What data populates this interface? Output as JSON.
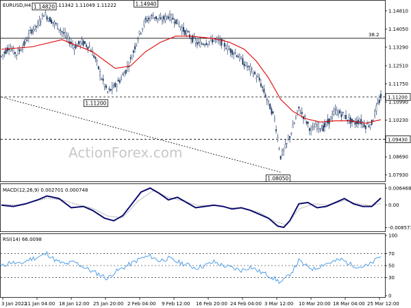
{
  "chart_data": {
    "type": "candlestick",
    "symbol_line": "EURUSD,H4  1.11101 1.11342 1.11049 1.11222",
    "watermark": "ActionForex.com",
    "y_ticks": [
      "1.14810",
      "1.14050",
      "1.13290",
      "1.12510",
      "1.11750",
      "1.10990",
      "1.10230",
      "1.09470",
      "1.08690",
      "1.07930"
    ],
    "y_range": [
      1.0775,
      1.1515
    ],
    "x_ticks": [
      "3 Jan 2022",
      "11 Jan 04:00",
      "18 Jan 12:00",
      "25 Jan 20:00",
      "2 Feb 04:00",
      "9 Feb 12:00",
      "16 Feb 20:00",
      "24 Feb 04:00",
      "3 Mar 12:00",
      "10 Mar 20:00",
      "18 Mar 04:00",
      "25 Mar 12:00"
    ],
    "price_labels": [
      {
        "text": "1.14820",
        "value": 1.1482,
        "bar": 28
      },
      {
        "text": "1.14940",
        "value": 1.1494,
        "bar": 95
      },
      {
        "text": "1.11200",
        "value": 1.112,
        "bar": 62
      },
      {
        "text": "1.08050",
        "value": 1.0805,
        "bar": 182
      }
    ],
    "fib_label": "38.2",
    "fib_level": 1.1366,
    "support_level": 1.0943,
    "support_label": "1.09430",
    "resistance_level": 1.112,
    "resistance_label": "1.11200",
    "trendline": [
      {
        "bar": 0,
        "value": 1.112
      },
      {
        "bar": 184,
        "value": 1.0805
      }
    ],
    "close_path": [
      [
        0,
        1.129
      ],
      [
        5,
        1.133
      ],
      [
        10,
        1.13
      ],
      [
        15,
        1.134
      ],
      [
        20,
        1.14
      ],
      [
        24,
        1.142
      ],
      [
        28,
        1.147
      ],
      [
        33,
        1.144
      ],
      [
        38,
        1.141
      ],
      [
        43,
        1.137
      ],
      [
        48,
        1.133
      ],
      [
        53,
        1.135
      ],
      [
        58,
        1.133
      ],
      [
        62,
        1.128
      ],
      [
        66,
        1.12
      ],
      [
        70,
        1.114
      ],
      [
        74,
        1.116
      ],
      [
        78,
        1.119
      ],
      [
        82,
        1.123
      ],
      [
        86,
        1.129
      ],
      [
        90,
        1.137
      ],
      [
        95,
        1.144
      ],
      [
        100,
        1.146
      ],
      [
        105,
        1.144
      ],
      [
        110,
        1.146
      ],
      [
        115,
        1.144
      ],
      [
        120,
        1.14
      ],
      [
        125,
        1.137
      ],
      [
        130,
        1.134
      ],
      [
        135,
        1.135
      ],
      [
        140,
        1.136
      ],
      [
        145,
        1.135
      ],
      [
        150,
        1.132
      ],
      [
        155,
        1.13
      ],
      [
        160,
        1.126
      ],
      [
        165,
        1.123
      ],
      [
        170,
        1.119
      ],
      [
        175,
        1.111
      ],
      [
        180,
        1.103
      ],
      [
        184,
        1.087
      ],
      [
        188,
        1.092
      ],
      [
        192,
        1.099
      ],
      [
        196,
        1.107
      ],
      [
        200,
        1.103
      ],
      [
        204,
        1.098
      ],
      [
        208,
        1.1
      ],
      [
        212,
        1.099
      ],
      [
        216,
        1.102
      ],
      [
        220,
        1.106
      ],
      [
        224,
        1.105
      ],
      [
        228,
        1.103
      ],
      [
        232,
        1.101
      ],
      [
        236,
        1.102
      ],
      [
        240,
        1.1
      ],
      [
        244,
        1.101
      ],
      [
        247,
        1.107
      ],
      [
        250,
        1.112
      ]
    ],
    "ma_path": [
      [
        0,
        1.132
      ],
      [
        20,
        1.133
      ],
      [
        40,
        1.136
      ],
      [
        60,
        1.131
      ],
      [
        75,
        1.124
      ],
      [
        85,
        1.125
      ],
      [
        95,
        1.131
      ],
      [
        105,
        1.135
      ],
      [
        115,
        1.1375
      ],
      [
        125,
        1.1375
      ],
      [
        140,
        1.1365
      ],
      [
        150,
        1.135
      ],
      [
        160,
        1.132
      ],
      [
        168,
        1.127
      ],
      [
        176,
        1.12
      ],
      [
        184,
        1.111
      ],
      [
        192,
        1.106
      ],
      [
        200,
        1.103
      ],
      [
        210,
        1.1015
      ],
      [
        220,
        1.102
      ],
      [
        230,
        1.102
      ],
      [
        240,
        1.101
      ],
      [
        250,
        1.1025
      ]
    ],
    "bars_total": 250,
    "macd": {
      "title": "MACD(12,26,9) 0.002701 0.000748",
      "ticks": [
        "0.006468",
        "0.00",
        "-0.008573"
      ],
      "range": [
        -0.0095,
        0.0075
      ],
      "macd_path": [
        [
          0,
          0.0
        ],
        [
          8,
          -0.0005
        ],
        [
          16,
          0.0005
        ],
        [
          24,
          0.002
        ],
        [
          30,
          0.0035
        ],
        [
          38,
          0.0025
        ],
        [
          46,
          -0.001
        ],
        [
          54,
          -0.0005
        ],
        [
          60,
          -0.002
        ],
        [
          68,
          -0.005
        ],
        [
          74,
          -0.006
        ],
        [
          80,
          -0.004
        ],
        [
          86,
          0.0005
        ],
        [
          92,
          0.005
        ],
        [
          98,
          0.0065
        ],
        [
          104,
          0.0045
        ],
        [
          110,
          0.002
        ],
        [
          116,
          0.003
        ],
        [
          122,
          0.001
        ],
        [
          128,
          -0.001
        ],
        [
          134,
          -0.0005
        ],
        [
          140,
          0.0
        ],
        [
          146,
          -0.0005
        ],
        [
          152,
          -0.0015
        ],
        [
          158,
          -0.001
        ],
        [
          164,
          -0.002
        ],
        [
          170,
          -0.0035
        ],
        [
          176,
          -0.005
        ],
        [
          182,
          -0.008
        ],
        [
          186,
          -0.0085
        ],
        [
          190,
          -0.006
        ],
        [
          196,
          0.0005
        ],
        [
          202,
          0.001
        ],
        [
          208,
          -0.001
        ],
        [
          214,
          -0.0005
        ],
        [
          220,
          0.001
        ],
        [
          226,
          0.0025
        ],
        [
          232,
          0.0005
        ],
        [
          238,
          -0.0005
        ],
        [
          244,
          -0.0005
        ],
        [
          250,
          0.0027
        ]
      ],
      "signal_path": [
        [
          0,
          0.0002
        ],
        [
          10,
          0.0
        ],
        [
          20,
          0.0012
        ],
        [
          30,
          0.0026
        ],
        [
          40,
          0.002
        ],
        [
          50,
          0.0002
        ],
        [
          60,
          -0.0012
        ],
        [
          70,
          -0.0042
        ],
        [
          80,
          -0.0048
        ],
        [
          90,
          0.0015
        ],
        [
          100,
          0.0055
        ],
        [
          110,
          0.003
        ],
        [
          120,
          0.0015
        ],
        [
          130,
          -0.0002
        ],
        [
          140,
          0.0
        ],
        [
          150,
          -0.001
        ],
        [
          160,
          -0.0012
        ],
        [
          170,
          -0.0028
        ],
        [
          180,
          -0.0062
        ],
        [
          188,
          -0.0076
        ],
        [
          196,
          -0.0015
        ],
        [
          206,
          0.0005
        ],
        [
          216,
          0.0
        ],
        [
          226,
          0.0018
        ],
        [
          236,
          0.0004
        ],
        [
          244,
          -0.0003
        ],
        [
          250,
          0.0007
        ]
      ]
    },
    "rsi": {
      "title": "RSI(14) 66.0098",
      "ticks": [
        "100",
        "70",
        "50",
        "30",
        "0"
      ],
      "range": [
        0,
        100
      ],
      "rsi_path": [
        [
          0,
          48
        ],
        [
          6,
          56
        ],
        [
          12,
          52
        ],
        [
          18,
          60
        ],
        [
          24,
          64
        ],
        [
          30,
          70
        ],
        [
          36,
          58
        ],
        [
          42,
          52
        ],
        [
          48,
          56
        ],
        [
          54,
          48
        ],
        [
          60,
          40
        ],
        [
          66,
          34
        ],
        [
          70,
          28
        ],
        [
          74,
          38
        ],
        [
          80,
          46
        ],
        [
          86,
          54
        ],
        [
          92,
          62
        ],
        [
          98,
          66
        ],
        [
          104,
          58
        ],
        [
          110,
          62
        ],
        [
          116,
          56
        ],
        [
          122,
          52
        ],
        [
          128,
          46
        ],
        [
          134,
          50
        ],
        [
          140,
          56
        ],
        [
          146,
          50
        ],
        [
          152,
          46
        ],
        [
          158,
          42
        ],
        [
          164,
          48
        ],
        [
          170,
          40
        ],
        [
          176,
          34
        ],
        [
          180,
          28
        ],
        [
          184,
          22
        ],
        [
          188,
          30
        ],
        [
          192,
          42
        ],
        [
          196,
          58
        ],
        [
          200,
          50
        ],
        [
          206,
          44
        ],
        [
          212,
          52
        ],
        [
          218,
          56
        ],
        [
          224,
          60
        ],
        [
          230,
          52
        ],
        [
          236,
          48
        ],
        [
          242,
          50
        ],
        [
          246,
          58
        ],
        [
          250,
          66
        ]
      ]
    },
    "colors": {
      "candle": "#1f3a66",
      "ma": "#e00000",
      "macd": "#0a0a6e",
      "signal": "#a0a0a0",
      "rsi": "#4f9fe6",
      "grid": "#000000"
    }
  }
}
